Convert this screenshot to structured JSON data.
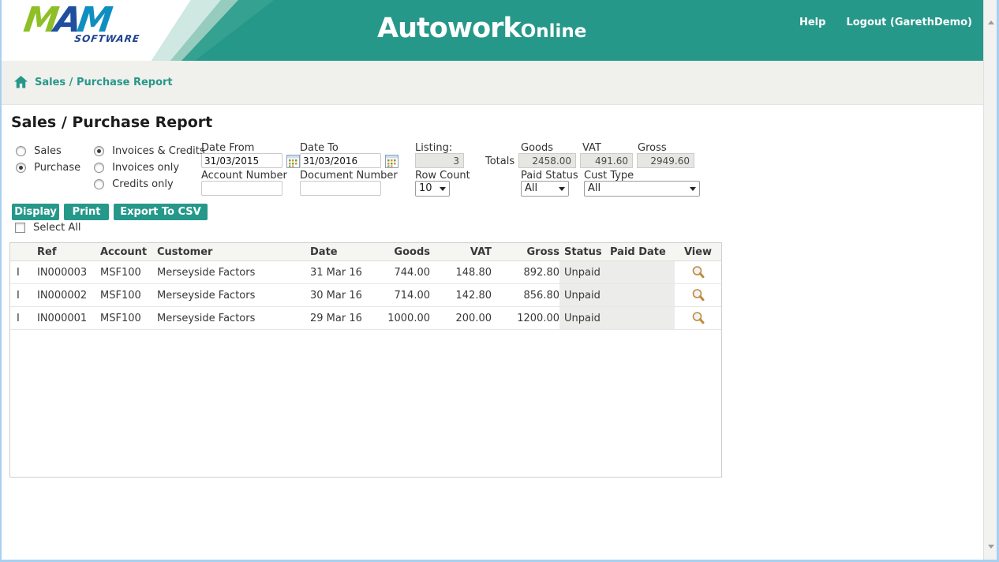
{
  "colors": {
    "accent_teal": "#26988a",
    "window_border_blue": "#a8d0f0",
    "status_cell_bg": "#ececea",
    "magnifier_gold": "#c08a3a"
  },
  "header": {
    "logo": {
      "m1": "M",
      "a": "A",
      "m2": "M",
      "subtitle": "SOFTWARE"
    },
    "app_title": {
      "main": "Autowork",
      "suffix": "Online"
    },
    "help_label": "Help",
    "logout_label": "Logout (GarethDemo)"
  },
  "breadcrumb": {
    "label": "Sales / Purchase Report"
  },
  "page_title": "Sales / Purchase Report",
  "filters": {
    "report_type": {
      "options": [
        {
          "label": "Sales",
          "selected": false
        },
        {
          "label": "Purchase",
          "selected": true
        }
      ]
    },
    "doc_type": {
      "options": [
        {
          "label": "Invoices & Credits",
          "selected": true
        },
        {
          "label": "Invoices only",
          "selected": false
        },
        {
          "label": "Credits only",
          "selected": false
        }
      ]
    },
    "date_from": {
      "label": "Date From",
      "value": "31/03/2015"
    },
    "date_to": {
      "label": "Date To",
      "value": "31/03/2016"
    },
    "account_number": {
      "label": "Account Number",
      "value": ""
    },
    "document_number": {
      "label": "Document Number",
      "value": ""
    },
    "listing": {
      "label": "Listing:",
      "value": "3"
    },
    "row_count": {
      "label": "Row Count",
      "value": "10"
    },
    "paid_status": {
      "label": "Paid Status",
      "value": "All"
    },
    "cust_type": {
      "label": "Cust Type",
      "value": "All"
    },
    "totals": {
      "label": "Totals",
      "goods_label": "Goods",
      "goods": "2458.00",
      "vat_label": "VAT",
      "vat": "491.60",
      "gross_label": "Gross",
      "gross": "2949.60"
    }
  },
  "actions": {
    "display": "Display",
    "print": "Print",
    "export_csv": "Export To CSV",
    "select_all_label": "Select All",
    "select_all_checked": false
  },
  "table": {
    "headers": {
      "type": "",
      "ref": "Ref",
      "account": "Account",
      "customer": "Customer",
      "date": "Date",
      "goods": "Goods",
      "vat": "VAT",
      "gross": "Gross",
      "status": "Status",
      "paid_date": "Paid Date",
      "view": "View"
    },
    "rows": [
      {
        "type": "I",
        "ref": "IN000003",
        "account": "MSF100",
        "customer": "Merseyside Factors",
        "date": "31 Mar 16",
        "goods": "744.00",
        "vat": "148.80",
        "gross": "892.80",
        "status": "Unpaid",
        "paid_date": ""
      },
      {
        "type": "I",
        "ref": "IN000002",
        "account": "MSF100",
        "customer": "Merseyside Factors",
        "date": "30 Mar 16",
        "goods": "714.00",
        "vat": "142.80",
        "gross": "856.80",
        "status": "Unpaid",
        "paid_date": ""
      },
      {
        "type": "I",
        "ref": "IN000001",
        "account": "MSF100",
        "customer": "Merseyside Factors",
        "date": "29 Mar 16",
        "goods": "1000.00",
        "vat": "200.00",
        "gross": "1200.00",
        "status": "Unpaid",
        "paid_date": ""
      }
    ]
  }
}
